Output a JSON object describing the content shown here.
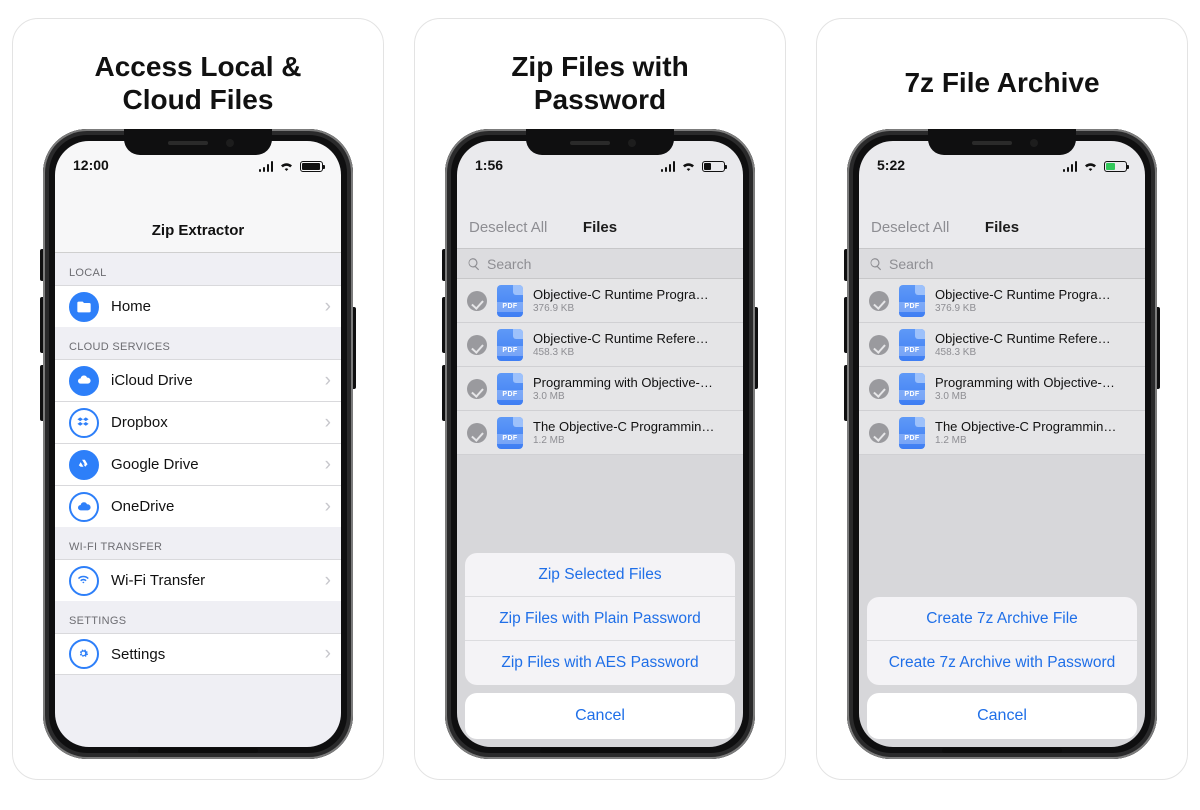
{
  "card1": {
    "title": "Access Local &\nCloud Files",
    "status_time": "12:00",
    "battery_pct": 92,
    "app_title": "Zip Extractor",
    "sections": [
      {
        "header": "LOCAL",
        "rows": [
          {
            "icon": "folder",
            "label": "Home"
          }
        ]
      },
      {
        "header": "CLOUD SERVICES",
        "rows": [
          {
            "icon": "icloud",
            "label": "iCloud Drive"
          },
          {
            "icon": "dropbox",
            "label": "Dropbox"
          },
          {
            "icon": "gdrive",
            "label": "Google Drive"
          },
          {
            "icon": "onedrive",
            "label": "OneDrive"
          }
        ]
      },
      {
        "header": "WI-FI TRANSFER",
        "rows": [
          {
            "icon": "wifi",
            "label": "Wi-Fi Transfer"
          }
        ]
      },
      {
        "header": "SETTINGS",
        "rows": [
          {
            "icon": "gear",
            "label": "Settings"
          }
        ]
      }
    ]
  },
  "card2": {
    "title": "Zip Files with\nPassword",
    "status_time": "1:56",
    "battery_pct": 35,
    "nav_left": "Deselect All",
    "nav_title": "Files",
    "search_placeholder": "Search",
    "files": [
      {
        "name": "Objective-C Runtime Programmin…",
        "size": "376.9 KB"
      },
      {
        "name": "Objective-C Runtime Reference.pdf",
        "size": "458.3 KB"
      },
      {
        "name": "Programming with Objective-C.pdf",
        "size": "3.0 MB"
      },
      {
        "name": "The Objective-C Programming Lan…",
        "size": "1.2 MB"
      }
    ],
    "actions": [
      "Zip Selected Files",
      "Zip Files with Plain Password",
      "Zip Files with AES Password"
    ],
    "cancel": "Cancel"
  },
  "card3": {
    "title": "7z File Archive",
    "status_time": "5:22",
    "battery_pct": 45,
    "battery_color": "green",
    "nav_left": "Deselect All",
    "nav_title": "Files",
    "search_placeholder": "Search",
    "files": [
      {
        "name": "Objective-C Runtime Programmin…",
        "size": "376.9 KB"
      },
      {
        "name": "Objective-C Runtime Reference.pdf",
        "size": "458.3 KB"
      },
      {
        "name": "Programming with Objective-C.pdf",
        "size": "3.0 MB"
      },
      {
        "name": "The Objective-C Programming Lan…",
        "size": "1.2 MB"
      }
    ],
    "actions": [
      "Create 7z Archive File",
      "Create 7z Archive with Password"
    ],
    "cancel": "Cancel"
  }
}
